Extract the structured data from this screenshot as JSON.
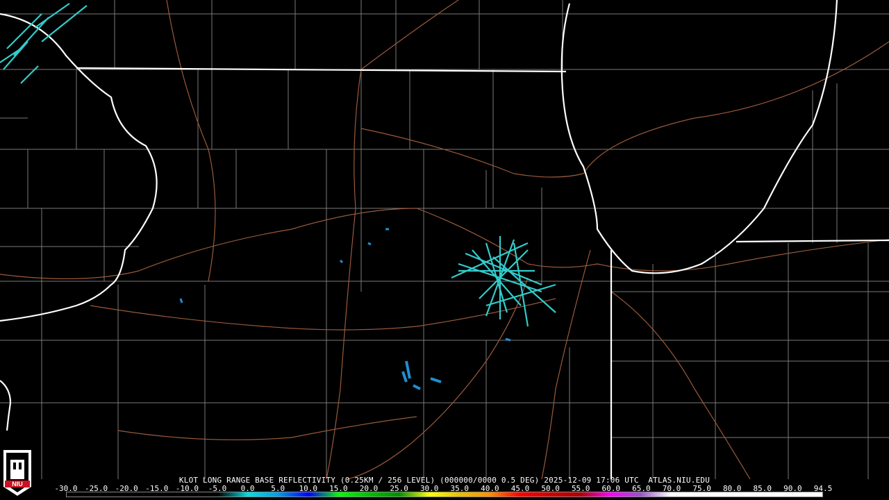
{
  "map": {
    "caption": "KLOT LONG RANGE BASE REFLECTIVITY (0.25KM / 256 LEVEL) (000000/0000 0.5 DEG) 2025-12-09 17:06 UTC  ATLAS.NIU.EDU",
    "logo_text": "NIU",
    "colors": {
      "background": "#000000",
      "state_border": "#ffffff",
      "county_line": "#7a7a7a",
      "highway": "#9a5a3a",
      "echo_light": "#33cccc",
      "echo_mid": "#1f8fd0"
    },
    "legend": {
      "ticks": [
        "-30.0",
        "-25.0",
        "-20.0",
        "-15.0",
        "-10.0",
        "-5.0",
        "0.0",
        "5.0",
        "10.0",
        "15.0",
        "20.0",
        "25.0",
        "30.0",
        "35.0",
        "40.0",
        "45.0",
        "50.0",
        "55.0",
        "60.0",
        "65.0",
        "70.0",
        "75.0",
        "80.0",
        "85.0",
        "90.0",
        "94.5"
      ],
      "colors": [
        "#000000",
        "#000000",
        "#000000",
        "#000000",
        "#000000",
        "#000000",
        "#00e0e0",
        "#009ce8",
        "#0000ff",
        "#00ff00",
        "#00c000",
        "#009000",
        "#ffff00",
        "#e8c000",
        "#ff9000",
        "#ff0000",
        "#d00000",
        "#b00000",
        "#ff00ff",
        "#9955c9",
        "#ffffff",
        "#ffffff",
        "#ffffff",
        "#ffffff",
        "#ffffff",
        "#ffffff"
      ]
    }
  }
}
